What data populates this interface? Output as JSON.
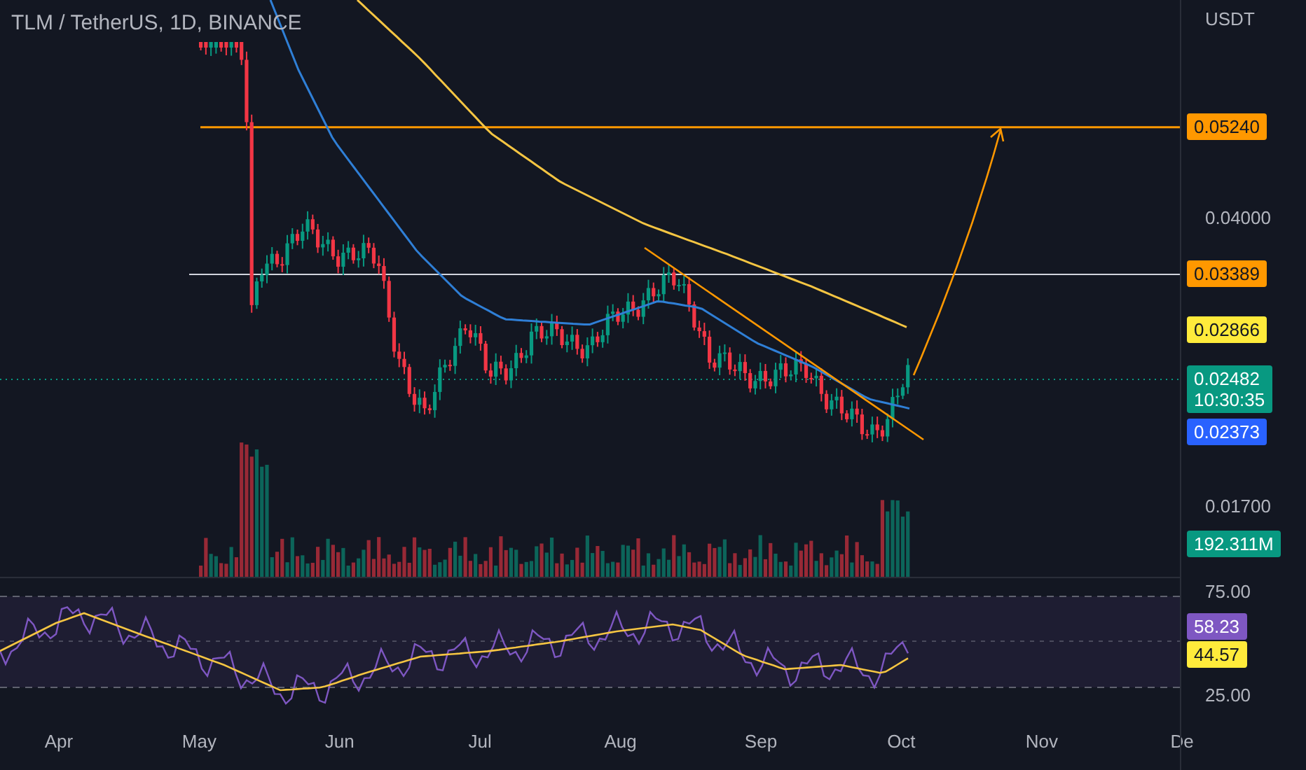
{
  "legend": {
    "title": "TLM / TetherUS, 1D, BINANCE"
  },
  "price_axis": {
    "currency": "USDT",
    "price_scale": [
      {
        "kind": "tag",
        "text": "0.05240",
        "color": "#ff9800"
      },
      {
        "kind": "tick",
        "text": "0.04000"
      },
      {
        "kind": "tag",
        "text": "0.03389",
        "color": "#ff9800"
      },
      {
        "kind": "tag",
        "text": "0.02866",
        "color": "#ffeb3b"
      },
      {
        "kind": "tag",
        "text": "0.02482",
        "countdown": "10:30:35",
        "color": "#089981"
      },
      {
        "kind": "tag",
        "text": "0.02373",
        "color": "#2962ff"
      },
      {
        "kind": "tick",
        "text": "0.01700"
      }
    ],
    "volume_scale": [
      {
        "kind": "tag",
        "text": "192.311M",
        "color": "#089981"
      }
    ],
    "rsi_scale": [
      {
        "kind": "tick",
        "text": "75.00"
      },
      {
        "kind": "tag",
        "text": "58.23",
        "color": "#7e57c2"
      },
      {
        "kind": "tag",
        "text": "44.57",
        "color": "#ffeb3b"
      },
      {
        "kind": "tick",
        "text": "25.00"
      }
    ]
  },
  "time_axis": {
    "labels": [
      "Apr",
      "May",
      "Jun",
      "Jul",
      "Aug",
      "Sep",
      "Oct",
      "Nov",
      "De"
    ]
  }
}
